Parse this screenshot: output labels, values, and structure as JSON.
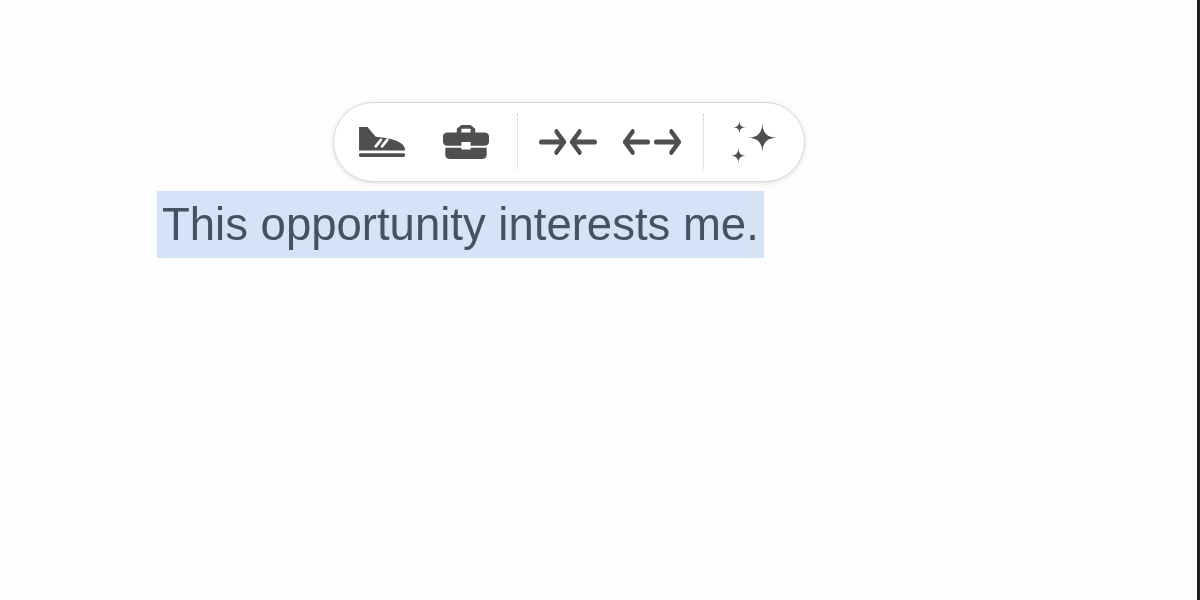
{
  "toolbar": {
    "groups": [
      {
        "buttons": [
          {
            "kind": "shoe"
          },
          {
            "kind": "briefcase"
          }
        ]
      },
      {
        "buttons": [
          {
            "kind": "arrows-in"
          },
          {
            "kind": "arrows-out"
          }
        ]
      },
      {
        "buttons": [
          {
            "kind": "sparkle"
          }
        ]
      }
    ]
  },
  "document": {
    "paragraphs": [
      {
        "text": "This opportunity interests me.",
        "selected": true
      }
    ]
  }
}
